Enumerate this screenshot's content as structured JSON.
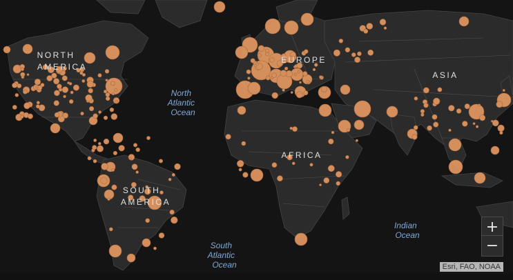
{
  "colors": {
    "ocean": "#141414",
    "land": "#2b2b2b",
    "border": "#5a5a5a",
    "coast": "#444444",
    "bubble": "#e89a63",
    "bubble_stroke": "#b8723f",
    "continent_label": "#e0e0e0",
    "ocean_label": "#7fa8d8"
  },
  "labels": {
    "continents": [
      {
        "name": "north-america",
        "lines": [
          "NORTH",
          "AMERICA"
        ]
      },
      {
        "name": "europe",
        "lines": [
          "EUROPE"
        ]
      },
      {
        "name": "asia",
        "lines": [
          "ASIA"
        ]
      },
      {
        "name": "africa",
        "lines": [
          "AFRICA"
        ]
      },
      {
        "name": "south-america",
        "lines": [
          "SOUTH",
          "AMERICA"
        ]
      }
    ],
    "oceans": [
      {
        "name": "north-atlantic",
        "lines": [
          "North",
          "Atlantic",
          "Ocean"
        ]
      },
      {
        "name": "south-atlantic",
        "lines": [
          "South",
          "Atlantic",
          "Ocean"
        ]
      },
      {
        "name": "indian",
        "lines": [
          "Indian",
          "Ocean"
        ]
      }
    ]
  },
  "controls": {
    "zoom_in": "+",
    "zoom_out": "−"
  },
  "attribution": "Esri, FAO, NOAA"
}
